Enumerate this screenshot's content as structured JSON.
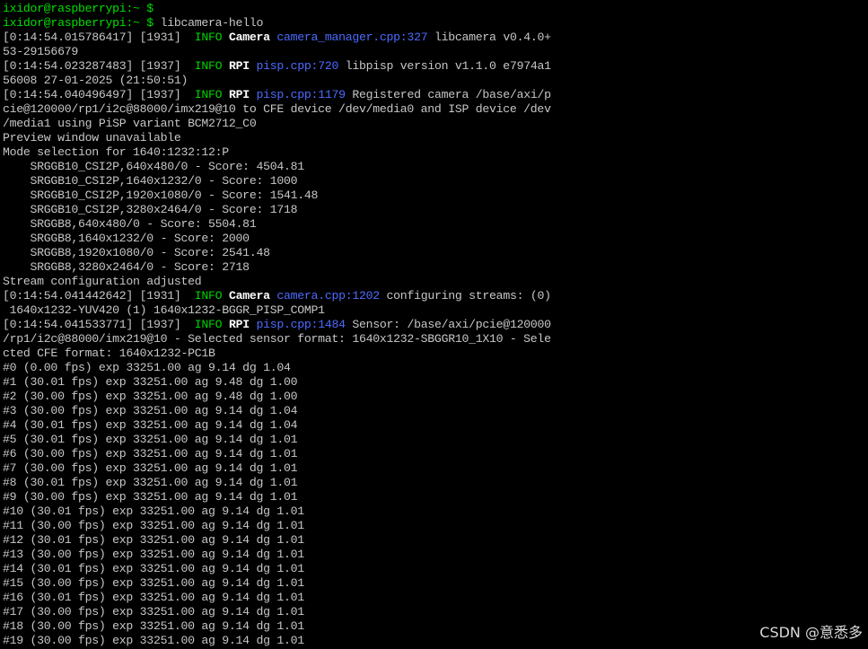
{
  "colors": {
    "background": "#000000",
    "text": "#c7c7c7",
    "prompt": "#00e000",
    "info": "#00d600",
    "source_link": "#4d6bff",
    "bold": "#ffffff"
  },
  "lines": [
    {
      "segments": [
        {
          "text": "ixidor@raspberrypi:~ $",
          "style": "prompt"
        }
      ]
    },
    {
      "segments": [
        {
          "text": "ixidor@raspberrypi:~ $",
          "style": "prompt"
        },
        {
          "text": " libcamera-hello",
          "style": "default"
        }
      ]
    },
    {
      "segments": [
        {
          "text": "[0:14:54.015786417] [1931]  ",
          "style": "default"
        },
        {
          "text": "INFO",
          "style": "info"
        },
        {
          "text": " ",
          "style": "default"
        },
        {
          "text": "Camera",
          "style": "bold"
        },
        {
          "text": " ",
          "style": "default"
        },
        {
          "text": "camera_manager.cpp:327",
          "style": "link"
        },
        {
          "text": " libcamera v0.4.0+",
          "style": "default"
        }
      ]
    },
    {
      "segments": [
        {
          "text": "53-29156679",
          "style": "default"
        }
      ]
    },
    {
      "segments": [
        {
          "text": "[0:14:54.023287483] [1937]  ",
          "style": "default"
        },
        {
          "text": "INFO",
          "style": "info"
        },
        {
          "text": " ",
          "style": "default"
        },
        {
          "text": "RPI",
          "style": "bold"
        },
        {
          "text": " ",
          "style": "default"
        },
        {
          "text": "pisp.cpp:720",
          "style": "link"
        },
        {
          "text": " libpisp version v1.1.0 e7974a1",
          "style": "default"
        }
      ]
    },
    {
      "segments": [
        {
          "text": "56008 27-01-2025 (21:50:51)",
          "style": "default"
        }
      ]
    },
    {
      "segments": [
        {
          "text": "[0:14:54.040496497] [1937]  ",
          "style": "default"
        },
        {
          "text": "INFO",
          "style": "info"
        },
        {
          "text": " ",
          "style": "default"
        },
        {
          "text": "RPI",
          "style": "bold"
        },
        {
          "text": " ",
          "style": "default"
        },
        {
          "text": "pisp.cpp:1179",
          "style": "link"
        },
        {
          "text": " Registered camera /base/axi/p",
          "style": "default"
        }
      ]
    },
    {
      "segments": [
        {
          "text": "cie@120000/rp1/i2c@88000/imx219@10 to CFE device /dev/media0 and ISP device /dev",
          "style": "default"
        }
      ]
    },
    {
      "segments": [
        {
          "text": "/media1 using PiSP variant BCM2712_C0",
          "style": "default"
        }
      ]
    },
    {
      "segments": [
        {
          "text": "Preview window unavailable",
          "style": "default"
        }
      ]
    },
    {
      "segments": [
        {
          "text": "Mode selection for 1640:1232:12:P",
          "style": "default"
        }
      ]
    },
    {
      "segments": [
        {
          "text": "    SRGGB10_CSI2P,640x480/0 - Score: 4504.81",
          "style": "default"
        }
      ]
    },
    {
      "segments": [
        {
          "text": "    SRGGB10_CSI2P,1640x1232/0 - Score: 1000",
          "style": "default"
        }
      ]
    },
    {
      "segments": [
        {
          "text": "    SRGGB10_CSI2P,1920x1080/0 - Score: 1541.48",
          "style": "default"
        }
      ]
    },
    {
      "segments": [
        {
          "text": "    SRGGB10_CSI2P,3280x2464/0 - Score: 1718",
          "style": "default"
        }
      ]
    },
    {
      "segments": [
        {
          "text": "    SRGGB8,640x480/0 - Score: 5504.81",
          "style": "default"
        }
      ]
    },
    {
      "segments": [
        {
          "text": "    SRGGB8,1640x1232/0 - Score: 2000",
          "style": "default"
        }
      ]
    },
    {
      "segments": [
        {
          "text": "    SRGGB8,1920x1080/0 - Score: 2541.48",
          "style": "default"
        }
      ]
    },
    {
      "segments": [
        {
          "text": "    SRGGB8,3280x2464/0 - Score: 2718",
          "style": "default"
        }
      ]
    },
    {
      "segments": [
        {
          "text": "Stream configuration adjusted",
          "style": "default"
        }
      ]
    },
    {
      "segments": [
        {
          "text": "[0:14:54.041442642] [1931]  ",
          "style": "default"
        },
        {
          "text": "INFO",
          "style": "info"
        },
        {
          "text": " ",
          "style": "default"
        },
        {
          "text": "Camera",
          "style": "bold"
        },
        {
          "text": " ",
          "style": "default"
        },
        {
          "text": "camera.cpp:1202",
          "style": "link"
        },
        {
          "text": " configuring streams: (0)",
          "style": "default"
        }
      ]
    },
    {
      "segments": [
        {
          "text": " 1640x1232-YUV420 (1) 1640x1232-BGGR_PISP_COMP1",
          "style": "default"
        }
      ]
    },
    {
      "segments": [
        {
          "text": "[0:14:54.041533771] [1937]  ",
          "style": "default"
        },
        {
          "text": "INFO",
          "style": "info"
        },
        {
          "text": " ",
          "style": "default"
        },
        {
          "text": "RPI",
          "style": "bold"
        },
        {
          "text": " ",
          "style": "default"
        },
        {
          "text": "pisp.cpp:1484",
          "style": "link"
        },
        {
          "text": " Sensor: /base/axi/pcie@120000",
          "style": "default"
        }
      ]
    },
    {
      "segments": [
        {
          "text": "/rp1/i2c@88000/imx219@10 - Selected sensor format: 1640x1232-SBGGR10_1X10 - Sele",
          "style": "default"
        }
      ]
    },
    {
      "segments": [
        {
          "text": "cted CFE format: 1640x1232-PC1B",
          "style": "default"
        }
      ]
    },
    {
      "segments": [
        {
          "text": "#0 (0.00 fps) exp 33251.00 ag 9.14 dg 1.04",
          "style": "default"
        }
      ]
    },
    {
      "segments": [
        {
          "text": "#1 (30.01 fps) exp 33251.00 ag 9.48 dg 1.00",
          "style": "default"
        }
      ]
    },
    {
      "segments": [
        {
          "text": "#2 (30.00 fps) exp 33251.00 ag 9.48 dg 1.00",
          "style": "default"
        }
      ]
    },
    {
      "segments": [
        {
          "text": "#3 (30.00 fps) exp 33251.00 ag 9.14 dg 1.04",
          "style": "default"
        }
      ]
    },
    {
      "segments": [
        {
          "text": "#4 (30.01 fps) exp 33251.00 ag 9.14 dg 1.04",
          "style": "default"
        }
      ]
    },
    {
      "segments": [
        {
          "text": "#5 (30.01 fps) exp 33251.00 ag 9.14 dg 1.01",
          "style": "default"
        }
      ]
    },
    {
      "segments": [
        {
          "text": "#6 (30.00 fps) exp 33251.00 ag 9.14 dg 1.01",
          "style": "default"
        }
      ]
    },
    {
      "segments": [
        {
          "text": "#7 (30.00 fps) exp 33251.00 ag 9.14 dg 1.01",
          "style": "default"
        }
      ]
    },
    {
      "segments": [
        {
          "text": "#8 (30.01 fps) exp 33251.00 ag 9.14 dg 1.01",
          "style": "default"
        }
      ]
    },
    {
      "segments": [
        {
          "text": "#9 (30.00 fps) exp 33251.00 ag 9.14 dg 1.01",
          "style": "default"
        }
      ]
    },
    {
      "segments": [
        {
          "text": "#10 (30.01 fps) exp 33251.00 ag 9.14 dg 1.01",
          "style": "default"
        }
      ]
    },
    {
      "segments": [
        {
          "text": "#11 (30.00 fps) exp 33251.00 ag 9.14 dg 1.01",
          "style": "default"
        }
      ]
    },
    {
      "segments": [
        {
          "text": "#12 (30.01 fps) exp 33251.00 ag 9.14 dg 1.01",
          "style": "default"
        }
      ]
    },
    {
      "segments": [
        {
          "text": "#13 (30.00 fps) exp 33251.00 ag 9.14 dg 1.01",
          "style": "default"
        }
      ]
    },
    {
      "segments": [
        {
          "text": "#14 (30.01 fps) exp 33251.00 ag 9.14 dg 1.01",
          "style": "default"
        }
      ]
    },
    {
      "segments": [
        {
          "text": "#15 (30.00 fps) exp 33251.00 ag 9.14 dg 1.01",
          "style": "default"
        }
      ]
    },
    {
      "segments": [
        {
          "text": "#16 (30.01 fps) exp 33251.00 ag 9.14 dg 1.01",
          "style": "default"
        }
      ]
    },
    {
      "segments": [
        {
          "text": "#17 (30.00 fps) exp 33251.00 ag 9.14 dg 1.01",
          "style": "default"
        }
      ]
    },
    {
      "segments": [
        {
          "text": "#18 (30.00 fps) exp 33251.00 ag 9.14 dg 1.01",
          "style": "default"
        }
      ]
    },
    {
      "segments": [
        {
          "text": "#19 (30.00 fps) exp 33251.00 ag 9.14 dg 1.01",
          "style": "default"
        }
      ]
    }
  ],
  "watermark": "CSDN @意悉多"
}
